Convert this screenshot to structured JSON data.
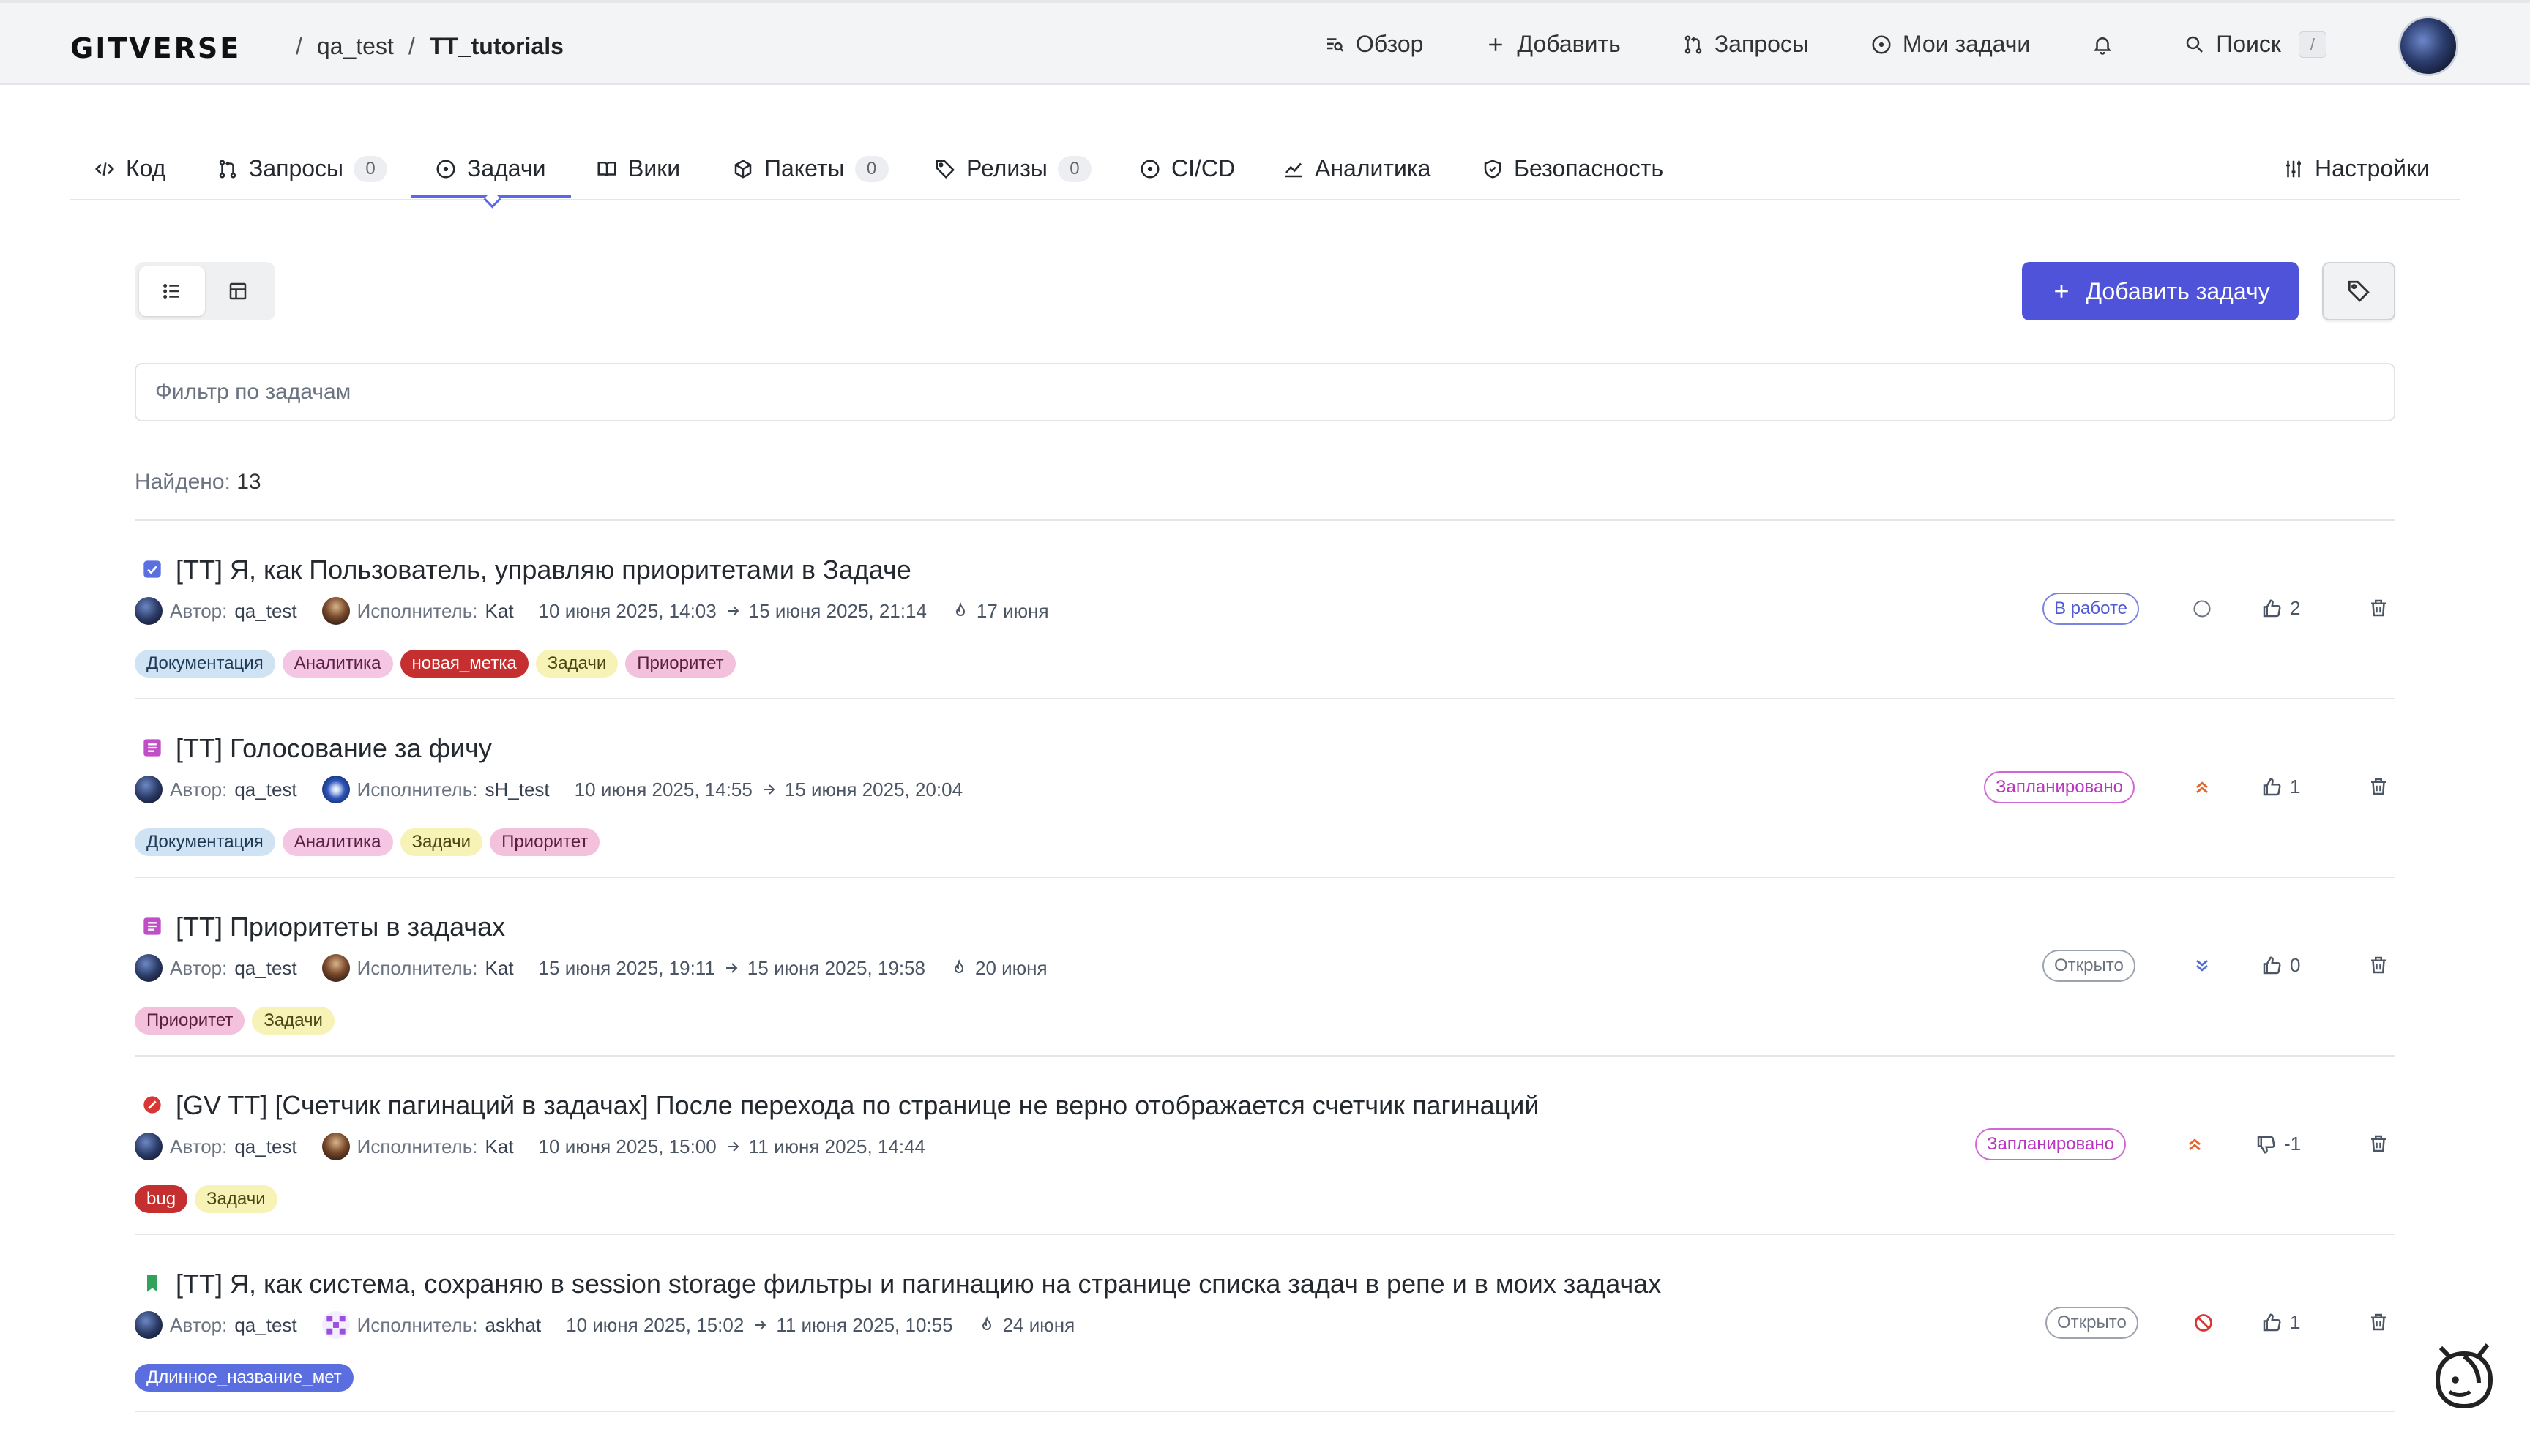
{
  "header": {
    "logo": "GITVERSE",
    "owner": "qa_test",
    "sep": "/",
    "repo": "TT_tutorials",
    "nav": {
      "overview": "Обзор",
      "add": "Добавить",
      "requests": "Запросы",
      "my_tasks": "Мои задачи",
      "search": "Поиск",
      "search_kbd": "/"
    }
  },
  "tabs": {
    "code": "Код",
    "requests": "Запросы",
    "requests_count": "0",
    "issues": "Задачи",
    "wiki": "Вики",
    "packages": "Пакеты",
    "packages_count": "0",
    "releases": "Релизы",
    "releases_count": "0",
    "cicd": "CI/CD",
    "analytics": "Аналитика",
    "security": "Безопасность",
    "settings": "Настройки",
    "active": "issues"
  },
  "toolbar": {
    "add_issue": "Добавить задачу",
    "filter_placeholder": "Фильтр по задачам",
    "found_label": "Найдено:",
    "found_count": "13"
  },
  "colors": {
    "accent": "#4f53d9",
    "status_work": "#4f5bd5",
    "status_planned": "#b935c0",
    "status_open": "#6b7280"
  },
  "issues": [
    {
      "type_icon": "checkbox-icon",
      "title": "[TT] Я, как Пользователь, управляю приоритетами в Задаче",
      "author_label": "Автор:",
      "author": "qa_test",
      "assignee_label": "Исполнитель:",
      "assignee": "Kat",
      "created": "10 июня 2025, 14:03",
      "updated": "15 июня 2025, 21:14",
      "due": "17 июня",
      "tags": [
        {
          "text": "Документация",
          "bg": "#cfe3f5",
          "fg": "#1f3a55"
        },
        {
          "text": "Аналитика",
          "bg": "#f5c6e4",
          "fg": "#5a1f45"
        },
        {
          "text": "новая_метка",
          "bg": "#c62f2f",
          "fg": "#ffffff"
        },
        {
          "text": "Задачи",
          "bg": "#f7f2b5",
          "fg": "#4a4512"
        },
        {
          "text": "Приоритет",
          "bg": "#f3c1dc",
          "fg": "#5a1f3f"
        }
      ],
      "status": "В работе",
      "priority_icon": "circle-empty-icon",
      "votes": "2",
      "vote_type": "thumbs-up"
    },
    {
      "type_icon": "story-icon",
      "title": "[TT] Голосование за фичу",
      "author_label": "Автор:",
      "author": "qa_test",
      "assignee_label": "Исполнитель:",
      "assignee": "sH_test",
      "created": "10 июня 2025, 14:55",
      "updated": "15 июня 2025, 20:04",
      "due": "",
      "tags": [
        {
          "text": "Документация",
          "bg": "#cfe3f5",
          "fg": "#1f3a55"
        },
        {
          "text": "Аналитика",
          "bg": "#f5c6e4",
          "fg": "#5a1f45"
        },
        {
          "text": "Задачи",
          "bg": "#f7f2b5",
          "fg": "#4a4512"
        },
        {
          "text": "Приоритет",
          "bg": "#f3c1dc",
          "fg": "#5a1f3f"
        }
      ],
      "status": "Запланировано",
      "priority_icon": "priority-high-icon",
      "votes": "1",
      "vote_type": "thumbs-up"
    },
    {
      "type_icon": "story-icon",
      "title": "[TT] Приоритеты в задачах",
      "author_label": "Автор:",
      "author": "qa_test",
      "assignee_label": "Исполнитель:",
      "assignee": "Kat",
      "created": "15 июня 2025, 19:11",
      "updated": "15 июня 2025, 19:58",
      "due": "20 июня",
      "tags": [
        {
          "text": "Приоритет",
          "bg": "#f3c1dc",
          "fg": "#5a1f3f"
        },
        {
          "text": "Задачи",
          "bg": "#f7f2b5",
          "fg": "#4a4512"
        }
      ],
      "status": "Открыто",
      "priority_icon": "priority-low-icon",
      "votes": "0",
      "vote_type": "thumbs-up"
    },
    {
      "type_icon": "bug-icon",
      "title": "[GV TT] [Счетчик пагинаций в задачах] После перехода по странице не верно отображается счетчик пагинаций",
      "author_label": "Автор:",
      "author": "qa_test",
      "assignee_label": "Исполнитель:",
      "assignee": "Kat",
      "created": "10 июня 2025, 15:00",
      "updated": "11 июня 2025, 14:44",
      "due": "",
      "tags": [
        {
          "text": "bug",
          "bg": "#c62f2f",
          "fg": "#ffffff"
        },
        {
          "text": "Задачи",
          "bg": "#f7f2b5",
          "fg": "#4a4512"
        }
      ],
      "status": "Запланировано",
      "priority_icon": "priority-high-icon",
      "votes": "-1",
      "vote_type": "thumbs-down"
    },
    {
      "type_icon": "bookmark-icon",
      "title": "[TT] Я, как система, сохраняю в session storage фильтры и пагинацию на странице списка задач в репе и в моих задачах",
      "author_label": "Автор:",
      "author": "qa_test",
      "assignee_label": "Исполнитель:",
      "assignee": "askhat",
      "created": "10 июня 2025, 15:02",
      "updated": "11 июня 2025, 10:55",
      "due": "24 июня",
      "tags": [
        {
          "text": "Длинное_название_мет",
          "bg": "#5b6ee0",
          "fg": "#ffffff"
        }
      ],
      "status": "Открыто",
      "priority_icon": "priority-blocked-icon",
      "votes": "1",
      "vote_type": "thumbs-up"
    }
  ]
}
